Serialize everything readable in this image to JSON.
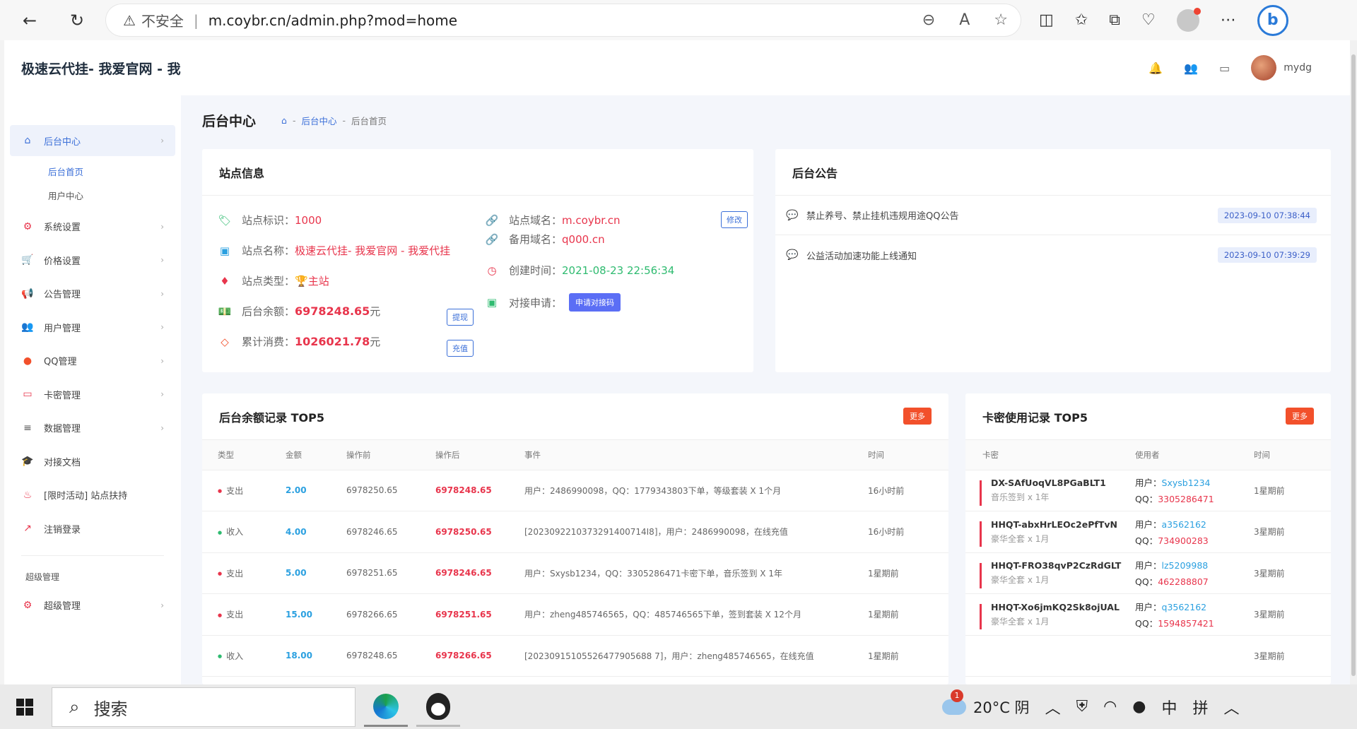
{
  "browser": {
    "insecure_label": "不安全",
    "url": "m.coybr.cn/admin.php?mod=home"
  },
  "brand": "极速云代挂- 我爱官网 - 我",
  "user": {
    "name": "mydg"
  },
  "sidebar": {
    "items": [
      {
        "label": "后台中心",
        "icon": "store-icon"
      },
      {
        "label": "系统设置",
        "icon": "gear-icon"
      },
      {
        "label": "价格设置",
        "icon": "cart-icon"
      },
      {
        "label": "公告管理",
        "icon": "megaphone-icon"
      },
      {
        "label": "用户管理",
        "icon": "users-icon"
      },
      {
        "label": "QQ管理",
        "icon": "qq-icon"
      },
      {
        "label": "卡密管理",
        "icon": "card-icon"
      },
      {
        "label": "数据管理",
        "icon": "list-icon"
      },
      {
        "label": "对接文档",
        "icon": "graduation-icon"
      },
      {
        "label": "[限时活动] 站点扶持",
        "icon": "fire-icon"
      },
      {
        "label": "注销登录",
        "icon": "logout-icon"
      }
    ],
    "subitems": [
      "后台首页",
      "用户中心"
    ],
    "section": "超级管理",
    "super_item": {
      "label": "超级管理",
      "icon": "gears-icon"
    }
  },
  "page": {
    "title": "后台中心",
    "crumbs": [
      "后台中心",
      "后台首页"
    ]
  },
  "site_info": {
    "title": "站点信息",
    "id_label": "站点标识：",
    "id_value": "1000",
    "name_label": "站点名称：",
    "name_value": "极速云代挂- 我爱官网 - 我爱代挂",
    "type_label": "站点类型：",
    "type_value": "主站",
    "balance_label": "后台余额：",
    "balance_value": "6978248.65",
    "balance_unit": " 元",
    "spent_label": "累计消费：",
    "spent_value": "1026021.78",
    "spent_unit": " 元",
    "domain_label": "站点域名：",
    "domain_value": "m.coybr.cn",
    "backup_label": "备用域名：",
    "backup_value": "q000.cn",
    "created_label": "创建时间：",
    "created_value": "2021-08-23 22:56:34",
    "dock_label": "对接申请：",
    "dock_btn": "申请对接码",
    "edit_btn": "修改",
    "withdraw_btn": "提现",
    "recharge_btn": "充值"
  },
  "notices": {
    "title": "后台公告",
    "items": [
      {
        "text": "禁止养号、禁止挂机违规用途QQ公告",
        "date": "2023-09-10 07:38:44"
      },
      {
        "text": "公益活动加速功能上线通知",
        "date": "2023-09-10 07:39:29"
      }
    ]
  },
  "balance_records": {
    "title": "后台余额记录 TOP5",
    "more": "更多",
    "headers": [
      "类型",
      "金额",
      "操作前",
      "操作后",
      "事件",
      "时间"
    ],
    "rows": [
      {
        "type": "支出",
        "kind": "out",
        "amount": "2.00",
        "before": "6978250.65",
        "after": "6978248.65",
        "event": "用户：2486990098，QQ：1779343803下单，等级套装 X 1个月",
        "time": "16小时前"
      },
      {
        "type": "收入",
        "kind": "in",
        "amount": "4.00",
        "before": "6978246.65",
        "after": "6978250.65",
        "event": "[2023092210373291400714I8]，用户：2486990098，在线充值",
        "time": "16小时前"
      },
      {
        "type": "支出",
        "kind": "out",
        "amount": "5.00",
        "before": "6978251.65",
        "after": "6978246.65",
        "event": "用户：Sxysb1234，QQ：3305286471卡密下单，音乐签到 X 1年",
        "time": "1星期前"
      },
      {
        "type": "支出",
        "kind": "out",
        "amount": "15.00",
        "before": "6978266.65",
        "after": "6978251.65",
        "event": "用户：zheng485746565，QQ：485746565下单，签到套装 X 12个月",
        "time": "1星期前"
      },
      {
        "type": "收入",
        "kind": "in",
        "amount": "18.00",
        "before": "6978248.65",
        "after": "6978266.65",
        "event": "[20230915105526477905688 7]，用户：zheng485746565，在线充值",
        "time": "1星期前"
      }
    ]
  },
  "card_records": {
    "title": "卡密使用记录 TOP5",
    "more": "更多",
    "headers": [
      "卡密",
      "使用者",
      "时间"
    ],
    "user_prefix": "用户：",
    "qq_prefix": "QQ：",
    "rows": [
      {
        "card": "DX-SAfUoqVL8PGaBLT1",
        "desc": "音乐签到 x 1年",
        "user": "Sxysb1234",
        "qq": "3305286471",
        "time": "1星期前"
      },
      {
        "card": "HHQT-abxHrLEOc2ePfTvN",
        "desc": "豪华全套 x 1月",
        "user": "a3562162",
        "qq": "734900283",
        "time": "3星期前"
      },
      {
        "card": "HHQT-FRO38qvP2CzRdGLT",
        "desc": "豪华全套 x 1月",
        "user": "lz5209988",
        "qq": "462288807",
        "time": "3星期前"
      },
      {
        "card": "HHQT-Xo6jmKQ2Sk8ojUAL",
        "desc": "豪华全套 x 1月",
        "user": "q3562162",
        "qq": "1594857421",
        "time": "3星期前"
      }
    ],
    "partial_time": "3星期前"
  },
  "taskbar": {
    "search": "搜索",
    "weather": "20°C 阴",
    "weather_badge": "1",
    "ime": "中",
    "ime2": "拼"
  }
}
